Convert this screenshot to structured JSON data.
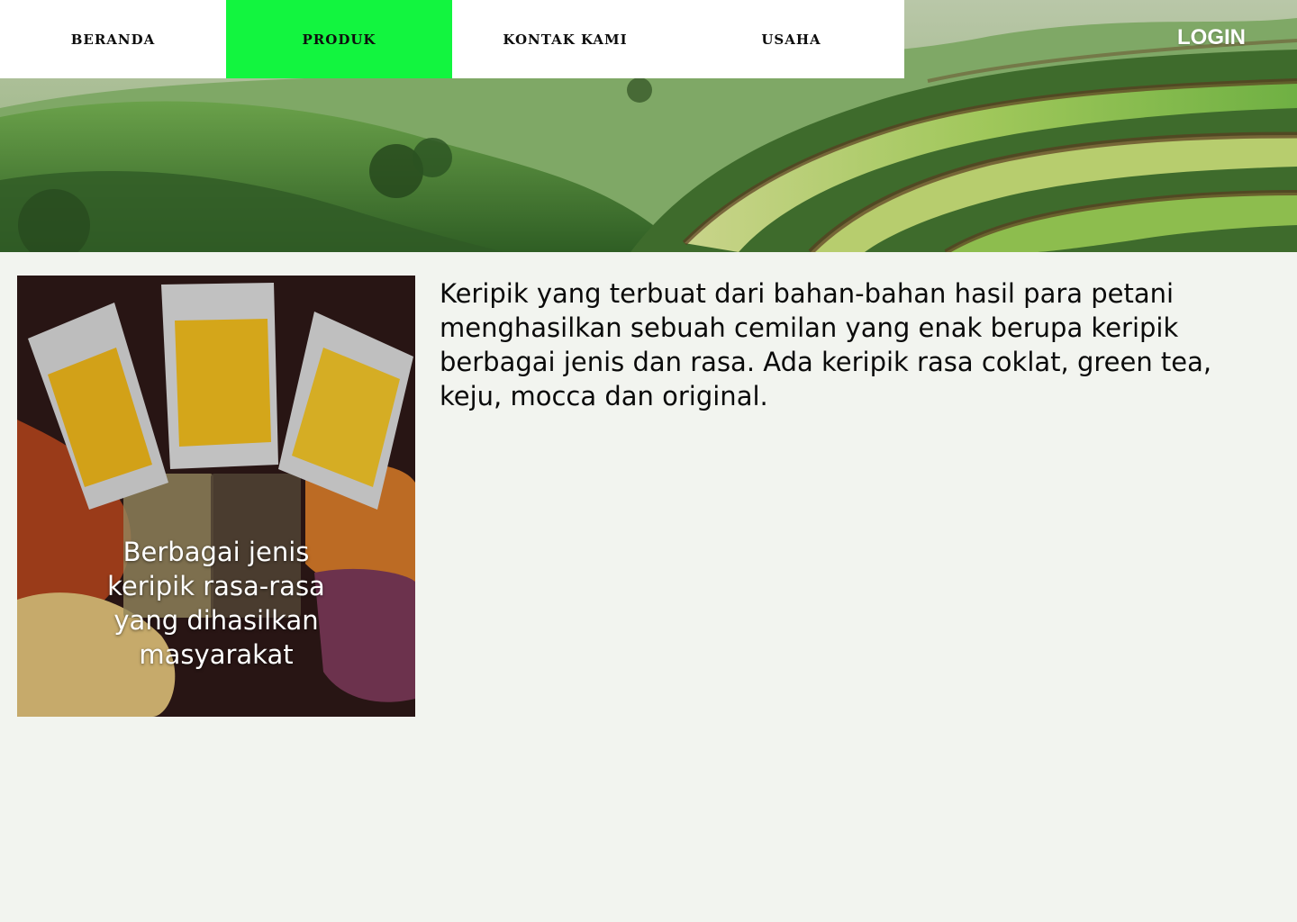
{
  "nav": {
    "items": [
      {
        "label": "BERANDA",
        "active": false
      },
      {
        "label": "PRODUK",
        "active": true
      },
      {
        "label": "KONTAK KAMI",
        "active": false
      },
      {
        "label": "USAHA",
        "active": false
      }
    ],
    "login_label": "LOGIN",
    "active_color": "#12f53f"
  },
  "hero": {
    "image": "rice-terraces-photo"
  },
  "product": {
    "image": "keripik-nanas-products-photo",
    "caption": "Berbagai jenis keripik rasa-rasa yang dihasilkan masyarakat",
    "description": "Keripik yang terbuat dari bahan-bahan hasil para petani menghasilkan sebuah cemilan yang enak berupa keripik berbagai jenis dan rasa. Ada keripik rasa coklat, green tea, keju, mocca dan original."
  },
  "colors": {
    "page_background": "#f2f4ef",
    "nav_background": "#ffffff",
    "text": "#0a0a0a"
  }
}
